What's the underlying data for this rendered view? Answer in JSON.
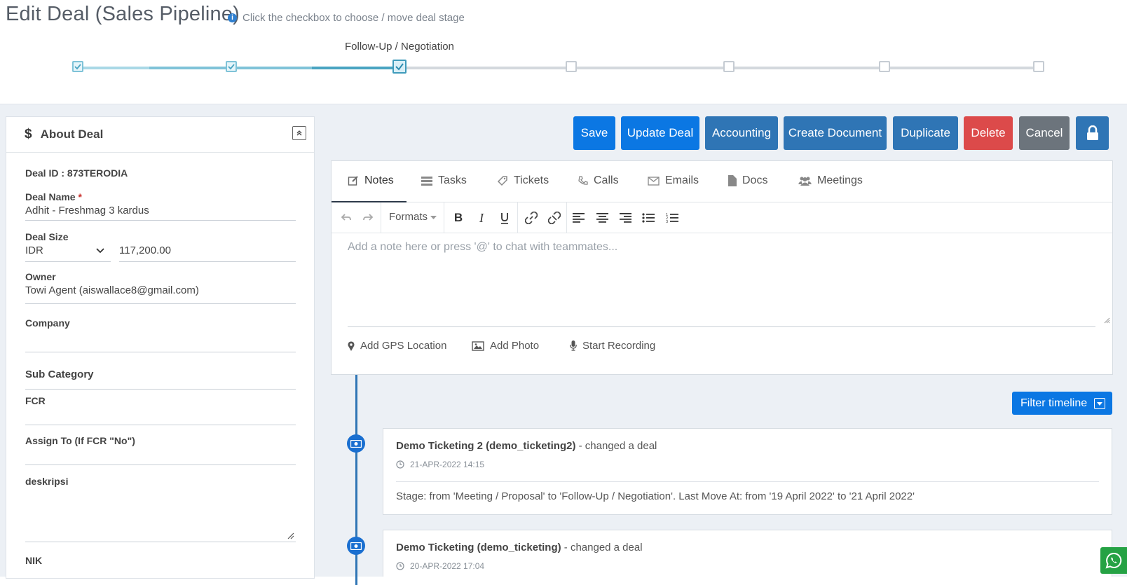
{
  "header": {
    "title": "Edit Deal (Sales Pipeline)",
    "hint": "Click the checkbox to choose / move deal stage",
    "current_stage": "Follow-Up / Negotiation"
  },
  "colors": {
    "primary": "#0b77e3",
    "steel": "#2f75b5",
    "danger": "#dc4a4a",
    "secondary": "#6c747c",
    "timeline": "#2f75b5",
    "whatsapp": "#25a244"
  },
  "about": {
    "title": "About Deal",
    "deal_id": "Deal ID : 873TERODIA",
    "deal_name_label": "Deal Name",
    "deal_name_required": "*",
    "deal_name": "Adhit - Freshmag 3 kardus",
    "deal_size_label": "Deal Size",
    "currency": "IDR",
    "amount": "117,200.00",
    "owner_label": "Owner",
    "owner": "Towi Agent (aiswallace8@gmail.com)",
    "company_label": "Company",
    "company": "",
    "subcategory_label": "Sub Category",
    "fcr_label": "FCR",
    "assign_label": "Assign To (If FCR \"No\")",
    "desc_label": "deskripsi",
    "nik_label": "NIK"
  },
  "actions": {
    "save": "Save",
    "update": "Update Deal",
    "accounting": "Accounting",
    "create_doc": "Create Document",
    "duplicate": "Duplicate",
    "delete": "Delete",
    "cancel": "Cancel"
  },
  "tabs": {
    "notes": "Notes",
    "tasks": "Tasks",
    "tickets": "Tickets",
    "calls": "Calls",
    "emails": "Emails",
    "docs": "Docs",
    "meetings": "Meetings"
  },
  "editor": {
    "formats": "Formats",
    "placeholder": "Add a note here or press '@' to chat with teammates...",
    "gps": "Add GPS Location",
    "photo": "Add Photo",
    "record": "Start Recording"
  },
  "timeline": {
    "filter_label": "Filter timeline",
    "items": [
      {
        "who": "Demo Ticketing 2 (demo_ticketing2)",
        "action": "- changed a deal",
        "time": "21-APR-2022 14:15",
        "body": "Stage: from 'Meeting / Proposal' to 'Follow-Up / Negotiation'. Last Move At: from '19 April 2022' to '21 April 2022'"
      },
      {
        "who": "Demo Ticketing (demo_ticketing)",
        "action": "- changed a deal",
        "time": "20-APR-2022 17:04"
      }
    ]
  }
}
